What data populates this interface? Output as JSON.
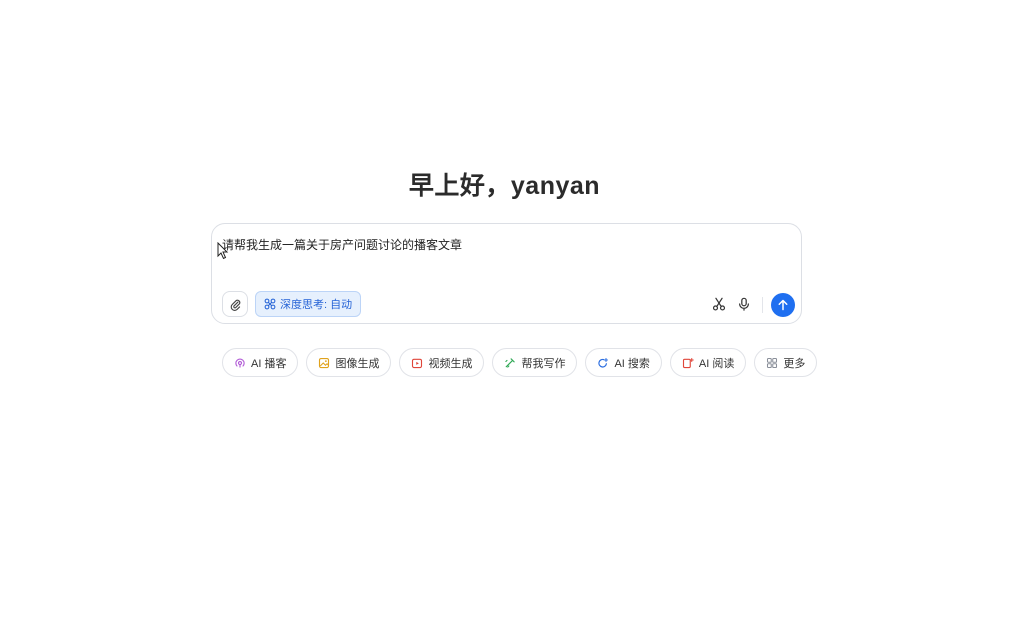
{
  "greeting": "早上好，yanyan",
  "composer": {
    "input_text": "请帮我生成一篇关于房产问题讨论的播客文章",
    "deep_think_label": "深度思考: 自动"
  },
  "icons": {
    "attach": "paperclip-icon",
    "deep_think": "atom-icon",
    "scissors": "scissors-icon",
    "mic": "microphone-icon",
    "send": "arrow-up-icon"
  },
  "chips": [
    {
      "label": "AI 播客",
      "icon": "podcast-icon",
      "color": "#b15ad6"
    },
    {
      "label": "图像生成",
      "icon": "image-icon",
      "color": "#e0a21c"
    },
    {
      "label": "视频生成",
      "icon": "video-icon",
      "color": "#e0463a"
    },
    {
      "label": "帮我写作",
      "icon": "pen-icon",
      "color": "#2fa855"
    },
    {
      "label": "AI 搜索",
      "icon": "search-sparkle-icon",
      "color": "#2d6fe0"
    },
    {
      "label": "AI 阅读",
      "icon": "book-icon",
      "color": "#e0463a"
    },
    {
      "label": "更多",
      "icon": "grid-icon",
      "color": "#8a8f99"
    }
  ],
  "colors": {
    "accent": "#1f6ff0",
    "deep_think_bg": "#e6f0fd",
    "deep_think_text": "#2563d6"
  }
}
